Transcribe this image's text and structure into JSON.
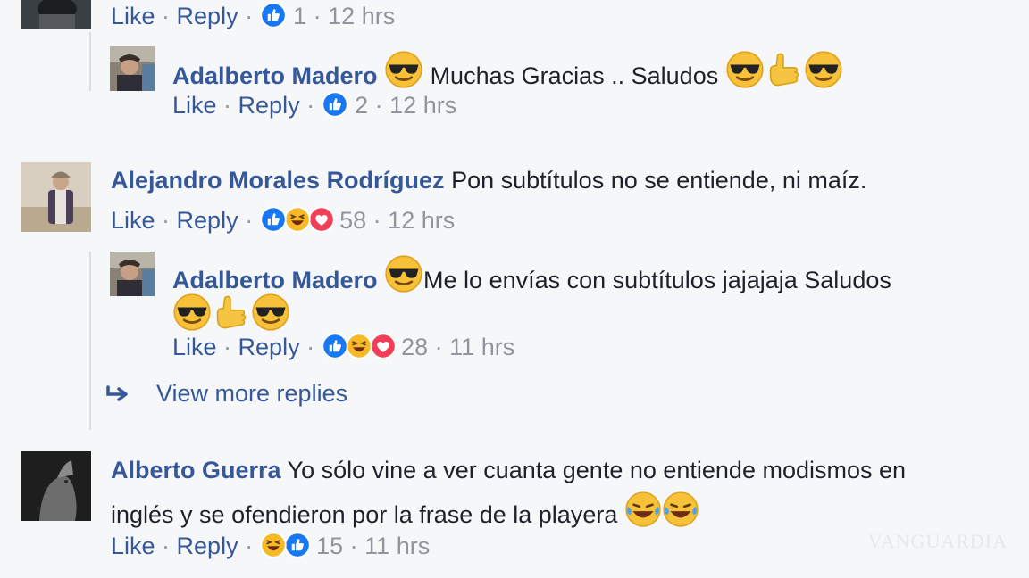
{
  "comments": [
    {
      "id": "c0",
      "actions": {
        "like": "Like",
        "reply": "Reply",
        "count": "1",
        "time": "12 hrs"
      },
      "reactions": [
        "like"
      ]
    },
    {
      "id": "r0",
      "author": "Adalberto Madero",
      "text": "Muchas Gracias .. Saludos",
      "actions": {
        "like": "Like",
        "reply": "Reply",
        "count": "2",
        "time": "12 hrs"
      },
      "reactions": [
        "like"
      ]
    },
    {
      "id": "c1",
      "author": "Alejandro Morales Rodríguez",
      "text": "Pon subtítulos no se entiende, ni maíz.",
      "actions": {
        "like": "Like",
        "reply": "Reply",
        "count": "58",
        "time": "12 hrs"
      },
      "reactions": [
        "like",
        "haha",
        "love"
      ]
    },
    {
      "id": "r1",
      "author": "Adalberto Madero",
      "text": "Me lo envías con subtítulos jajajaja Saludos",
      "actions": {
        "like": "Like",
        "reply": "Reply",
        "count": "28",
        "time": "11 hrs"
      },
      "reactions": [
        "like",
        "haha",
        "love"
      ]
    },
    {
      "id": "c2",
      "author": "Alberto Guerra",
      "text_line1": "Yo sólo vine a ver cuanta gente no entiende modismos en",
      "text_line2": "inglés y se ofendieron por la frase de la playera",
      "actions": {
        "like": "Like",
        "reply": "Reply",
        "count": "15",
        "time": "11 hrs"
      },
      "reactions": [
        "haha",
        "like"
      ]
    }
  ],
  "view_more_replies": "View more replies",
  "watermark": "VANGUARDIA",
  "colors": {
    "name": "#365899",
    "meta": "#90949c",
    "like": "#1877f2",
    "love": "#f33e58",
    "haha": "#f7b928"
  },
  "icons": {
    "reply_arrow": "reply-arrow-icon",
    "sunglasses": "sunglasses-emoji",
    "point": "pointing-finger-emoji",
    "laugh": "tears-of-joy-emoji"
  }
}
